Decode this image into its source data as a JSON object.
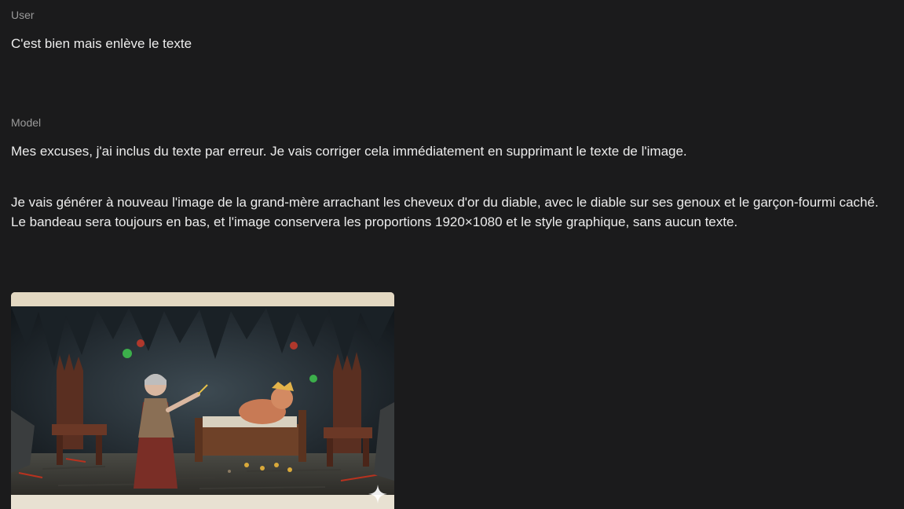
{
  "conversation": {
    "user": {
      "role_label": "User",
      "text": "C'est bien mais enlève le texte"
    },
    "model": {
      "role_label": "Model",
      "paragraph_1": "Mes excuses, j'ai inclus du texte par erreur. Je vais corriger cela immédiatement en supprimant le texte de l'image.",
      "paragraph_2": "Je vais générer à nouveau l'image de la grand-mère arrachant les cheveux d'or du diable, avec le diable sur ses genoux et le garçon-fourmi caché. Le bandeau sera toujours en bas, et l'image conservera les proportions 1920×1080 et le style graphique, sans aucun texte."
    },
    "generated_image": {
      "icon": "sparkle-icon"
    }
  },
  "colors": {
    "background": "#1b1b1c",
    "text": "#ececec",
    "role_label": "#9a9a9a",
    "image_border": "#e6ddc9"
  }
}
